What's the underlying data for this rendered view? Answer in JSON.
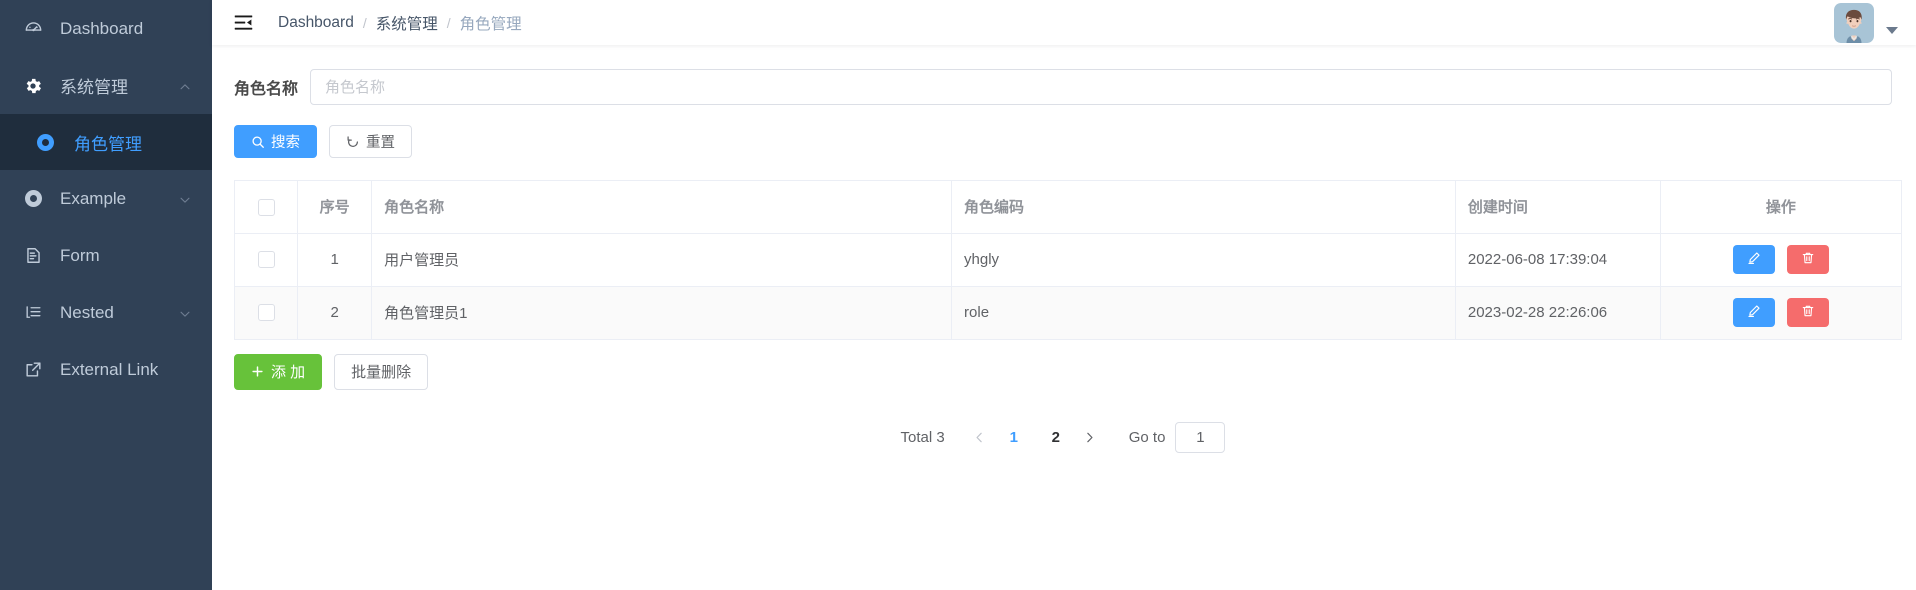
{
  "theme": {
    "sidebar_bg": "#304156",
    "sidebar_active_bg": "#1f2d3d",
    "accent": "#409eff",
    "success": "#67c23a",
    "danger": "#f56c6c",
    "text_muted": "#909399"
  },
  "sidebar": {
    "items": [
      {
        "label": "Dashboard",
        "icon": "dashboard-icon",
        "has_arrow": false,
        "active": false,
        "sub": false
      },
      {
        "label": "系统管理",
        "icon": "gear-icon",
        "has_arrow": true,
        "arrow": "chevron-up-icon",
        "active": false,
        "sub": false
      },
      {
        "label": "角色管理",
        "icon": "circle-target-icon",
        "has_arrow": false,
        "active": true,
        "sub": true
      },
      {
        "label": "Example",
        "icon": "circle-target-icon",
        "has_arrow": true,
        "arrow": "chevron-down-icon",
        "active": false,
        "sub": false
      },
      {
        "label": "Form",
        "icon": "form-icon",
        "has_arrow": false,
        "active": false,
        "sub": false
      },
      {
        "label": "Nested",
        "icon": "nested-list-icon",
        "has_arrow": true,
        "arrow": "chevron-down-icon",
        "active": false,
        "sub": false
      },
      {
        "label": "External Link",
        "icon": "external-link-icon",
        "has_arrow": false,
        "active": false,
        "sub": false
      }
    ]
  },
  "navbar": {
    "hamburger_icon": "hamburger-collapse-icon",
    "breadcrumb": [
      {
        "label": "Dashboard",
        "link": true
      },
      {
        "label": "系统管理",
        "link": true
      },
      {
        "label": "角色管理",
        "link": false
      }
    ],
    "separator": "/",
    "avatar_icon": "user-avatar",
    "caret_icon": "caret-down-icon"
  },
  "filter": {
    "label": "角色名称",
    "input_value": "",
    "input_placeholder": "角色名称",
    "search_button": {
      "label": "搜索",
      "icon": "search-icon"
    },
    "reset_button": {
      "label": "重置",
      "icon": "refresh-icon"
    }
  },
  "table": {
    "select_all_checked": false,
    "columns": [
      {
        "key": "checkbox",
        "label": "",
        "align": "center"
      },
      {
        "key": "index",
        "label": "序号",
        "align": "center"
      },
      {
        "key": "name",
        "label": "角色名称",
        "align": "left"
      },
      {
        "key": "code",
        "label": "角色编码",
        "align": "left"
      },
      {
        "key": "created",
        "label": "创建时间",
        "align": "left"
      },
      {
        "key": "ops",
        "label": "操作",
        "align": "center"
      }
    ],
    "rows": [
      {
        "checked": false,
        "index": "1",
        "name": "用户管理员",
        "code": "yhgly",
        "created": "2022-06-08 17:39:04",
        "hover": false,
        "edit_button": {
          "icon": "pencil-edit-icon",
          "label": ""
        },
        "delete_button": {
          "icon": "trash-delete-icon",
          "label": ""
        }
      },
      {
        "checked": false,
        "index": "2",
        "name": "角色管理员1",
        "code": "role",
        "created": "2023-02-28 22:26:06",
        "hover": true,
        "edit_button": {
          "icon": "pencil-edit-icon",
          "label": ""
        },
        "delete_button": {
          "icon": "trash-delete-icon",
          "label": ""
        }
      }
    ]
  },
  "table_actions": {
    "add_button": {
      "label": "添 加",
      "icon": "plus-icon"
    },
    "batch_delete_button": {
      "label": "批量删除"
    }
  },
  "pagination": {
    "total_label": "Total 3",
    "prev_icon": "chevron-left-icon",
    "next_icon": "chevron-right-icon",
    "pages": [
      {
        "label": "1",
        "current": true
      },
      {
        "label": "2",
        "current": false
      }
    ],
    "jump_label": "Go to",
    "jump_value": "1"
  }
}
